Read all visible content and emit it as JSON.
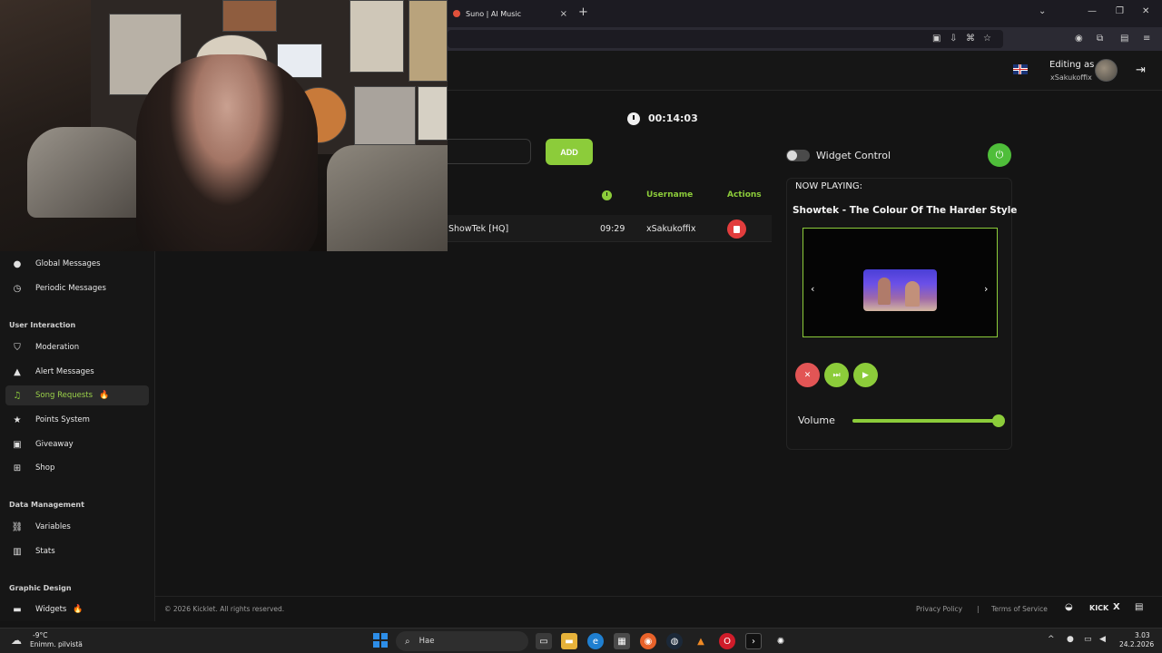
{
  "browser": {
    "tab_title": "Suno | AI Music",
    "tab_close": "×",
    "new_tab": "+",
    "win_dropdown": "⌄",
    "win_minimize": "—",
    "win_restore": "❐",
    "win_close": "✕"
  },
  "header": {
    "editing_as": "Editing as",
    "username": "xSakukoffix"
  },
  "sidebar": {
    "items_top": [
      {
        "label": "Global Messages",
        "icon": "chat-bubble-icon"
      },
      {
        "label": "Periodic Messages",
        "icon": "clock-icon"
      }
    ],
    "sections": [
      {
        "title": "User Interaction",
        "items": [
          {
            "label": "Moderation",
            "icon": "shield-icon"
          },
          {
            "label": "Alert Messages",
            "icon": "warning-icon"
          },
          {
            "label": "Song Requests",
            "icon": "music-note-icon",
            "active": true,
            "badge": "🔥"
          },
          {
            "label": "Points System",
            "icon": "star-icon"
          },
          {
            "label": "Giveaway",
            "icon": "gift-icon"
          },
          {
            "label": "Shop",
            "icon": "cart-icon"
          }
        ]
      },
      {
        "title": "Data Management",
        "items": [
          {
            "label": "Variables",
            "icon": "link-icon"
          },
          {
            "label": "Stats",
            "icon": "bar-chart-icon"
          }
        ]
      },
      {
        "title": "Graphic Design",
        "items": [
          {
            "label": "Widgets",
            "icon": "monitor-icon",
            "badge": "🔥"
          }
        ]
      }
    ]
  },
  "queue": {
    "timer": "00:14:03",
    "add_label": "ADD",
    "columns": {
      "username": "Username",
      "actions": "Actions"
    },
    "rows": [
      {
        "title": "ShowTek [HQ]",
        "duration": "09:29",
        "username": "xSakukoffix"
      }
    ]
  },
  "widget": {
    "control_label": "Widget Control",
    "power": "⏻",
    "now_playing_label": "NOW PLAYING:",
    "now_playing_title": "Showtek - The Colour Of The Harder Style",
    "prev": "‹",
    "next": "›",
    "volume_label": "Volume",
    "volume_value": 0.99
  },
  "footer": {
    "copyright": "© 2026 Kicklet. All rights reserved.",
    "privacy": "Privacy Policy",
    "separator": "|",
    "terms": "Terms of Service",
    "kick": "KICK",
    "x": "X"
  },
  "taskbar": {
    "temp": "-9°C",
    "weather": "Enimm. pilvistä",
    "search_placeholder": "Hae",
    "time": "3.03",
    "date": "24.2.2026"
  },
  "colors": {
    "accent": "#8ccc3a",
    "danger": "#e23d3d",
    "background": "#141414"
  }
}
